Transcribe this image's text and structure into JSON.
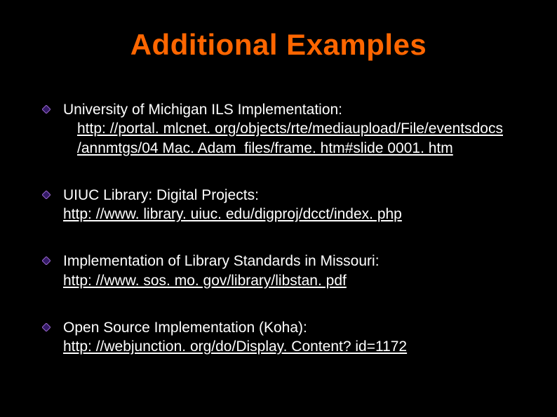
{
  "title": "Additional Examples",
  "bullets": [
    {
      "label": "University of Michigan ILS Implementation:",
      "link_line1": "http: //portal. mlcnet. org/objects/rte/mediaupload/File/eventsdocs",
      "link_line2": "/annmtgs/04 Mac. Adam_files/frame. htm#slide 0001. htm"
    },
    {
      "label": "UIUC Library: Digital Projects:",
      "link": "http: //www. library. uiuc. edu/digproj/dcct/index. php"
    },
    {
      "label": "Implementation of Library Standards in Missouri:",
      "link": "http: //www. sos. mo. gov/library/libstan. pdf"
    },
    {
      "label": "Open Source Implementation (Koha):",
      "link": "http: //webjunction. org/do/Display. Content? id=1172"
    }
  ],
  "colors": {
    "background": "#000000",
    "title": "#ff6600",
    "text": "#ffffff",
    "bullet_fill": "#331a66",
    "bullet_stroke": "#9966cc"
  }
}
